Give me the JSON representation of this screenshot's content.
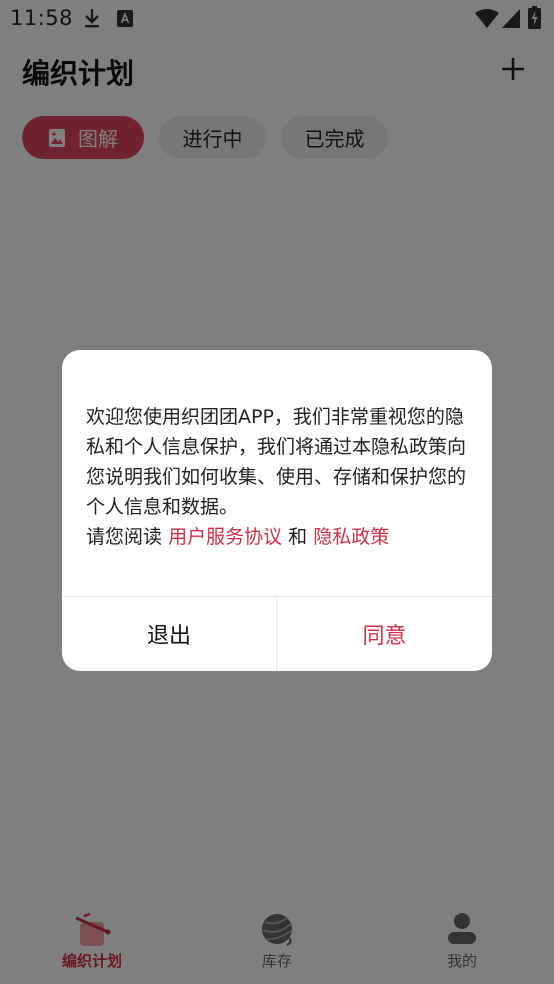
{
  "status_bar": {
    "time": "11:58"
  },
  "header": {
    "title": "编织计划"
  },
  "tabs": [
    {
      "label": "图解"
    },
    {
      "label": "进行中"
    },
    {
      "label": "已完成"
    }
  ],
  "bottom_nav": [
    {
      "label": "编织计划"
    },
    {
      "label": "库存"
    },
    {
      "label": "我的"
    }
  ],
  "dialog": {
    "body": "欢迎您使用织团团APP，我们非常重视您的隐私和个人信息保护，我们将通过本隐私政策向您说明我们如何收集、使用、存储和保护您的个人信息和数据。",
    "read_prefix": "请您阅读",
    "user_agreement": "用户服务协议",
    "and": "和",
    "privacy_policy": "隐私政策",
    "exit_label": "退出",
    "agree_label": "同意"
  },
  "colors": {
    "accent": "#d0304a",
    "tab_active": "#e04560",
    "overlay": "rgba(0,0,0,0.5)"
  }
}
